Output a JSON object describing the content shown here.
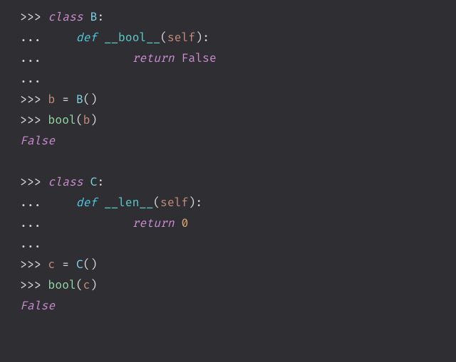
{
  "prompts": {
    "primary": ">>>",
    "cont": "..."
  },
  "kw": {
    "class": "class",
    "def": "def",
    "ret": "return",
    "false": "False"
  },
  "names": {
    "B": "B",
    "C": "C",
    "b": "b",
    "c": "c",
    "bool_dunder": "__bool__",
    "len_dunder": "__len__",
    "self": "self",
    "bool_fn": "bool"
  },
  "punct": {
    "colon": ":",
    "lp": "(",
    "rp": ")",
    "eq": "=",
    "zero": "0"
  },
  "outputs": {
    "false1": "False",
    "false2": "False"
  }
}
